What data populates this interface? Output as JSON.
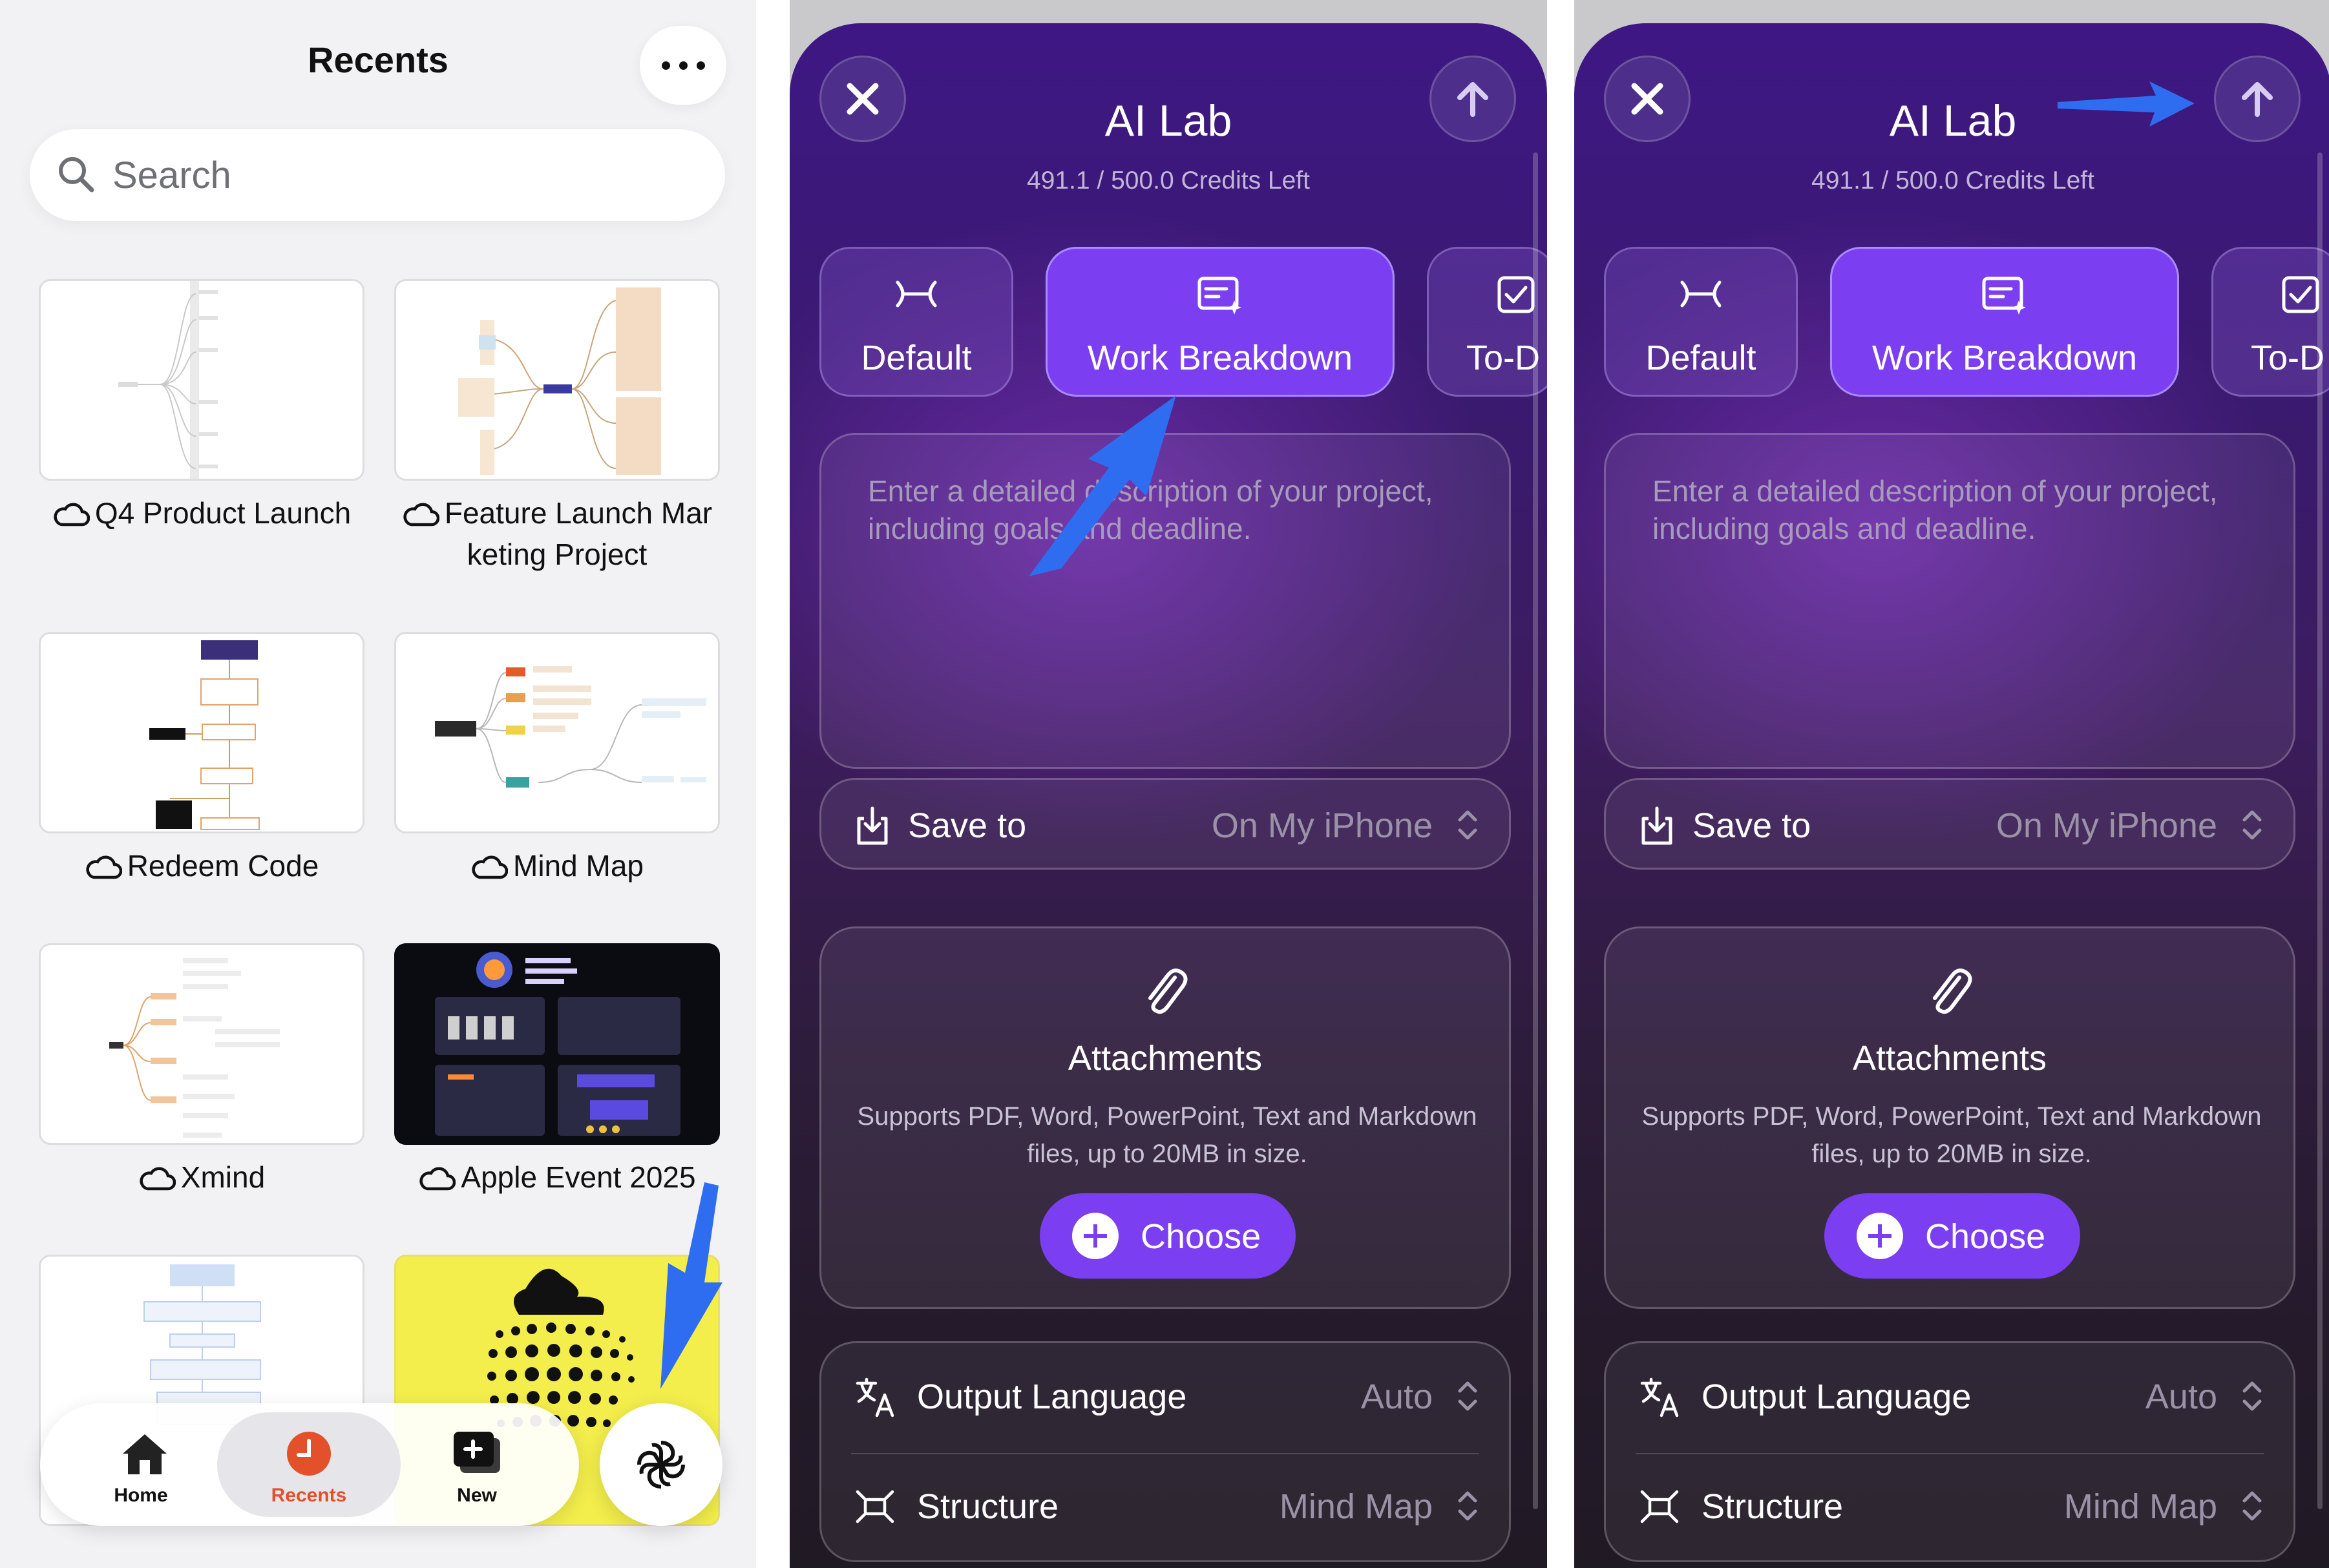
{
  "recents": {
    "title": "Recents",
    "search_placeholder": "Search",
    "files": [
      {
        "name": "Q4 Product Launch"
      },
      {
        "name": "Feature Launch Mar keting Project"
      },
      {
        "name": "Redeem Code"
      },
      {
        "name": "Mind Map"
      },
      {
        "name": "Xmind"
      },
      {
        "name": "Apple Event 2025"
      }
    ],
    "tabbar": {
      "home": "Home",
      "recents": "Recents",
      "new": "New"
    }
  },
  "ai_lab": {
    "title": "AI Lab",
    "credits": "491.1 / 500.0 Credits Left",
    "modes": [
      {
        "label": "Default"
      },
      {
        "label": "Work Breakdown",
        "selected": true
      },
      {
        "label": "To-D"
      }
    ],
    "description_placeholder": "Enter a detailed description of your project, including goals and deadline.",
    "save_to": {
      "label": "Save to",
      "value": "On My iPhone"
    },
    "attachments": {
      "title": "Attachments",
      "description": "Supports PDF, Word, PowerPoint, Text and Markdown files, up to 20MB in size.",
      "choose_label": "Choose"
    },
    "output_language": {
      "label": "Output Language",
      "value": "Auto"
    },
    "structure": {
      "label": "Structure",
      "value": "Mind Map"
    }
  },
  "colors": {
    "accent_purple": "#7b3ef0",
    "recents_active": "#e2512a",
    "annotation_arrow": "#2f6df0"
  }
}
